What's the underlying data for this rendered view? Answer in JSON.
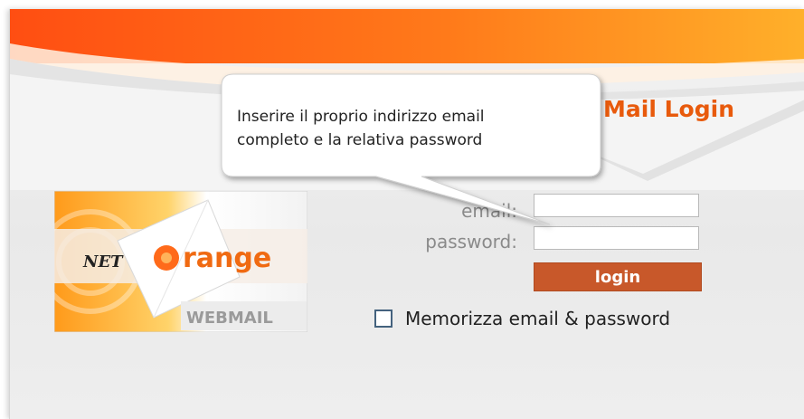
{
  "header": {
    "title": "Mail Login"
  },
  "logo": {
    "text_net": "NET",
    "text_orange": "range",
    "text_webmail": "WEBMAIL"
  },
  "form": {
    "email_label": "email:",
    "email_value": "",
    "password_label": "password:",
    "password_value": "",
    "login_label": "login",
    "remember_label": "Memorizza email & password",
    "remember_checked": false
  },
  "tooltip": {
    "text_line1": "Inserire il proprio indirizzo email",
    "text_line2": "completo e la relativa password"
  },
  "colors": {
    "accent_orange": "#e85a0c",
    "login_button": "#c8582a",
    "checkbox_border": "#44627e"
  }
}
